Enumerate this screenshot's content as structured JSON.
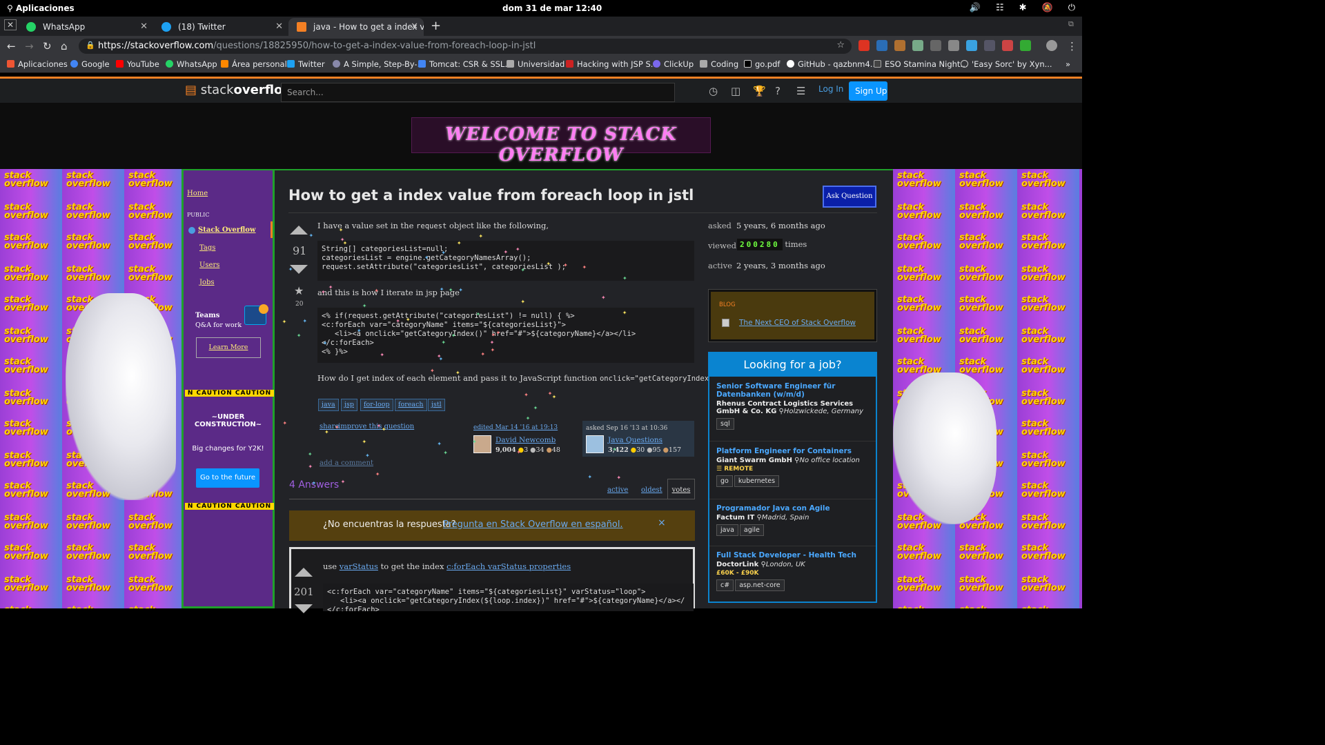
{
  "os": {
    "apps_label": "Aplicaciones",
    "datetime": "dom 31 de mar   12:40"
  },
  "browser": {
    "tabs": [
      {
        "label": "WhatsApp"
      },
      {
        "label": "(18) Twitter"
      },
      {
        "label": "java - How to get a index value"
      }
    ],
    "url_host": "https://stackoverflow.com",
    "url_path": "/questions/18825950/how-to-get-a-index-value-from-foreach-loop-in-jstl",
    "bookmarks": [
      "Aplicaciones",
      "Google",
      "YouTube",
      "WhatsApp",
      "Área personal",
      "Twitter",
      "A Simple, Step-By-...",
      "Tomcat: CSR & SSL...",
      "Universidad",
      "Hacking with JSP S...",
      "ClickUp",
      "Coding",
      "go.pdf",
      "GitHub - qazbnm4...",
      "ESO Stamina Night...",
      "'Easy Sorc' by Xyn..."
    ]
  },
  "so": {
    "logo_a": "stack",
    "logo_b": "overflow",
    "search_placeholder": "Search...",
    "login": "Log In",
    "signup": "Sign Up",
    "banner": "WELCOME TO STACK OVERFLOW",
    "tile_text": "stack overflow"
  },
  "sidebar": {
    "home": "Home",
    "public": "PUBLIC",
    "so": "Stack Overflow",
    "tags": "Tags",
    "users": "Users",
    "jobs": "Jobs",
    "teams": "Teams",
    "teams_sub": "Q&A for work",
    "learn_more": "Learn More",
    "caution": "N  CAUTION   CAUTION",
    "under": "~UNDER CONSTRUCTION~",
    "big_changes": "Big changes for Y2K!",
    "future": "Go to the future"
  },
  "question": {
    "title": "How to get a index value from foreach loop in jstl",
    "ask_button": "Ask Question",
    "votes": "91",
    "favorites": "20",
    "p1a": "I have a value set in the",
    "p1code": "request",
    "p1b": "object like the following,",
    "code1": [
      "String[] categoriesList=null;",
      "categoriesList = engine.getCategoryNamesArray();",
      "request.setAttribute(\"categoriesList\", categoriesList );"
    ],
    "p2": "and this is how I iterate in jsp page",
    "code2": [
      "<% if(request.getAttribute(\"categoriesList\") != null) { %>",
      "<c:forEach var=\"categoryName\" items=\"${categoriesList}\">",
      "   <li><a onclick=\"getCategoryIndex()\" href=\"#\">${categoryName}</a></li>",
      "</c:forEach>",
      "<% }%>"
    ],
    "p3a": "How do I get index of each element and pass it to JavaScript function",
    "p3code": "onclick=\"getCategoryIndex()\"",
    "p3b": ".",
    "tags": [
      "java",
      "jsp",
      "for-loop",
      "foreach",
      "jstl"
    ],
    "share": "share",
    "improve": "improve this question",
    "edited": "edited Mar 14 '16 at 19:13",
    "editor": "David Newcomb",
    "editor_rep": "9,004",
    "editor_badges": [
      "3",
      "34",
      "48"
    ],
    "asked_on": "asked Sep 16 '13 at 10:36",
    "asker": "Java Questions",
    "asker_rep": "3,422",
    "asker_badges": [
      "30",
      "95",
      "157"
    ],
    "add_comment": "add a comment"
  },
  "stats": {
    "asked_l": "asked",
    "asked_v": "5 years, 6 months ago",
    "viewed_l": "viewed",
    "viewed_v": "200280",
    "viewed_s": "times",
    "active_l": "active",
    "active_v": "2 years, 3 months ago"
  },
  "blog": {
    "label": "BLOG",
    "item": "The Next CEO of Stack Overflow"
  },
  "jobs": {
    "title": "Looking for a job?",
    "items": [
      {
        "title": "Senior Software Engineer für Datenbanken (w/m/d)",
        "company": "Rhenus Contract Logistics Services GmbH & Co. KG",
        "loc": "Holzwickede, Germany",
        "tags": [
          "sql"
        ]
      },
      {
        "title": "Platform Engineer for Containers",
        "company": "Giant Swarm GmbH",
        "loc": "No office location",
        "remote": "REMOTE",
        "tags": [
          "go",
          "kubernetes"
        ]
      },
      {
        "title": "Programador Java con Agile",
        "company": "Factum IT",
        "loc": "Madrid, Spain",
        "tags": [
          "java",
          "agile"
        ]
      },
      {
        "title": "Full Stack Developer - Health Tech",
        "company": "DoctorLink",
        "loc": "London, UK",
        "salary": "£60K - £90K",
        "tags": [
          "c#",
          "asp.net-core"
        ]
      }
    ]
  },
  "answers": {
    "count": "4 Answers",
    "sort": [
      "active",
      "oldest",
      "votes"
    ],
    "notice": "¿No encuentras la respuesta?",
    "notice_link": "Pregunta en Stack Overflow en español.",
    "notice_close": "×",
    "a1_votes": "201",
    "a1_text_a": "use",
    "a1_link1": "varStatus",
    "a1_text_b": "to get the index",
    "a1_link2": "c:forEach varStatus properties",
    "a1_code": [
      "<c:forEach var=\"categoryName\" items=\"${categoriesList}\" varStatus=\"loop\">",
      "   <li><a onclick=\"getCategoryIndex(${loop.index})\" href=\"#\">${categoryName}</a></",
      "</c:forEach>"
    ]
  }
}
